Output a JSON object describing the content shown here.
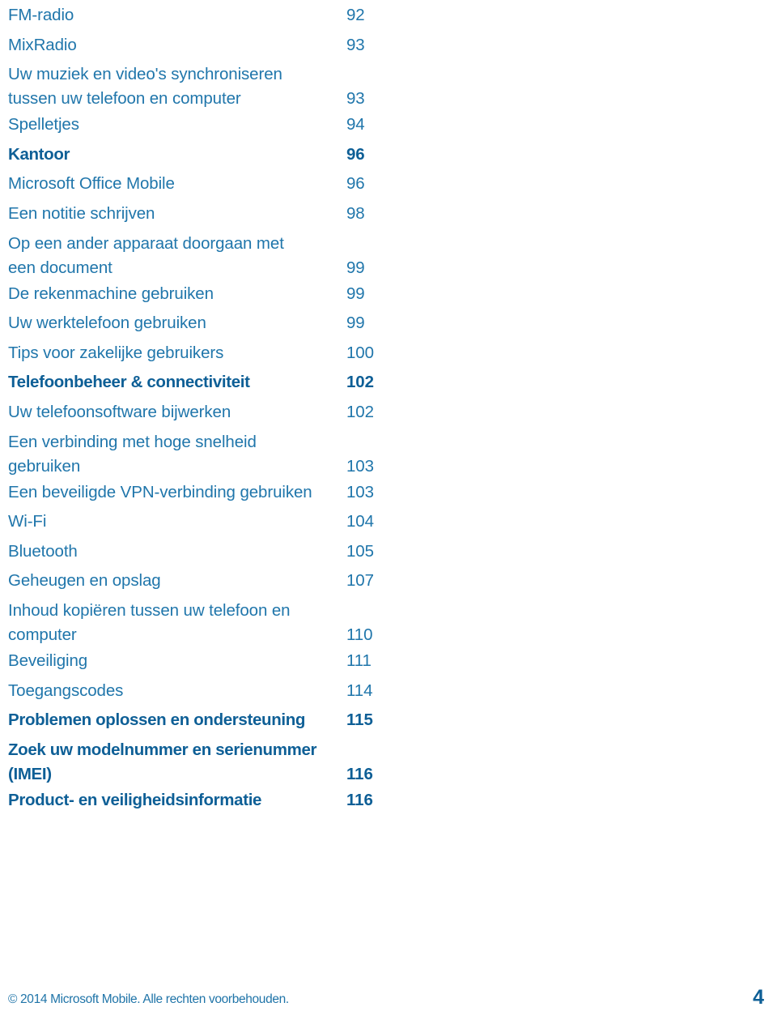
{
  "document": {
    "type": "table-of-contents",
    "language": "nl"
  },
  "toc": {
    "entries": [
      {
        "title": "FM-radio",
        "page": "92",
        "bold": false,
        "lines": 1
      },
      {
        "title": "MixRadio",
        "page": "93",
        "bold": false,
        "lines": 1
      },
      {
        "title": "Uw muziek en video's synchroniseren\ntussen uw telefoon en computer",
        "page": "93",
        "bold": false,
        "lines": 2
      },
      {
        "title": "Spelletjes",
        "page": "94",
        "bold": false,
        "lines": 1
      },
      {
        "title": "Kantoor",
        "page": "96",
        "bold": true,
        "lines": 1
      },
      {
        "title": "Microsoft Office Mobile",
        "page": "96",
        "bold": false,
        "lines": 1
      },
      {
        "title": "Een notitie schrijven",
        "page": "98",
        "bold": false,
        "lines": 1
      },
      {
        "title": "Op een ander apparaat doorgaan met\neen document",
        "page": "99",
        "bold": false,
        "lines": 2
      },
      {
        "title": "De rekenmachine gebruiken",
        "page": "99",
        "bold": false,
        "lines": 1
      },
      {
        "title": "Uw werktelefoon gebruiken",
        "page": "99",
        "bold": false,
        "lines": 1
      },
      {
        "title": "Tips voor zakelijke gebruikers",
        "page": "100",
        "bold": false,
        "lines": 1
      },
      {
        "title": "Telefoonbeheer & connectiviteit",
        "page": "102",
        "bold": true,
        "lines": 1
      },
      {
        "title": "Uw telefoonsoftware bijwerken",
        "page": "102",
        "bold": false,
        "lines": 1
      },
      {
        "title": "Een verbinding met hoge snelheid\ngebruiken",
        "page": "103",
        "bold": false,
        "lines": 2
      },
      {
        "title": "Een beveiligde VPN-verbinding gebruiken",
        "page": "103",
        "bold": false,
        "lines": 1
      },
      {
        "title": "Wi-Fi",
        "page": "104",
        "bold": false,
        "lines": 1
      },
      {
        "title": "Bluetooth",
        "page": "105",
        "bold": false,
        "lines": 1
      },
      {
        "title": "Geheugen en opslag",
        "page": "107",
        "bold": false,
        "lines": 1
      },
      {
        "title": "Inhoud kopiëren tussen uw telefoon en\ncomputer",
        "page": "110",
        "bold": false,
        "lines": 2
      },
      {
        "title": "Beveiliging",
        "page": "111",
        "bold": false,
        "lines": 1
      },
      {
        "title": "Toegangscodes",
        "page": "114",
        "bold": false,
        "lines": 1
      },
      {
        "title": "Problemen oplossen en ondersteuning",
        "page": "115",
        "bold": true,
        "lines": 1
      },
      {
        "title": "Zoek uw modelnummer en serienummer\n(IMEI)",
        "page": "116",
        "bold": true,
        "lines": 2
      },
      {
        "title": "Product- en veiligheidsinformatie",
        "page": "116",
        "bold": true,
        "lines": 1
      }
    ]
  },
  "footer": {
    "copyright": "© 2014 Microsoft Mobile. Alle rechten voorbehouden.",
    "page_number": "4"
  },
  "colors": {
    "text_regular": "#2076ab",
    "text_bold": "#0e5f96",
    "background": "#ffffff"
  }
}
